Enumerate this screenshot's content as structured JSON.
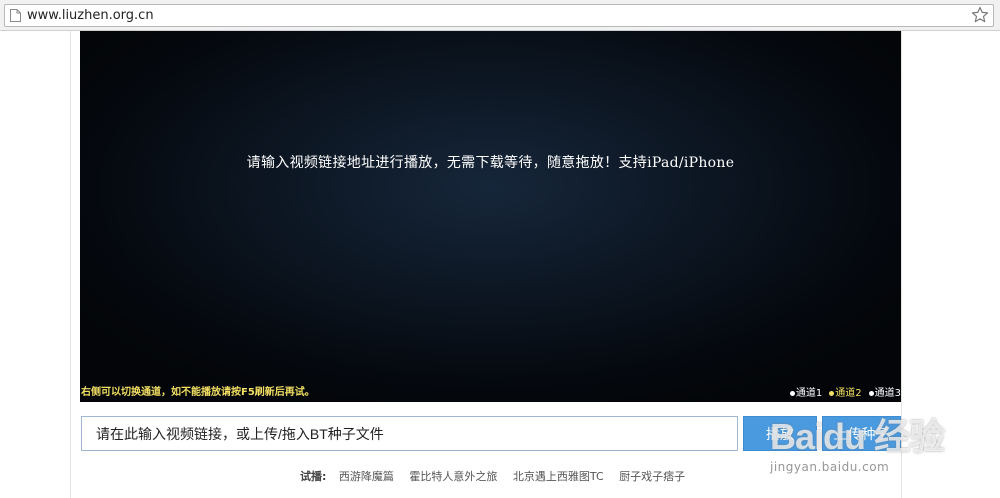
{
  "browser": {
    "url": "www.liuzhen.org.cn"
  },
  "player": {
    "message": "请输入视频链接地址进行播放，无需下载等待，随意拖放！支持iPad/iPhone",
    "hint": "右侧可以切换通道，如不能播放请按F5刷新后再试。",
    "channels": [
      {
        "label": "通道1",
        "active": false
      },
      {
        "label": "通道2",
        "active": true
      },
      {
        "label": "通道3",
        "active": false
      }
    ]
  },
  "search": {
    "placeholder": "请在此输入视频链接，或上传/拖入BT种子文件",
    "play_label": "播放",
    "upload_label": "上传种子"
  },
  "try_play": {
    "label": "试播:",
    "items": [
      "西游降魔篇",
      "霍比特人意外之旅",
      "北京遇上西雅图TC",
      "厨子戏子痞子"
    ]
  },
  "watermark": {
    "brand": "Baidu 经验",
    "site": "jingyan.baidu.com"
  },
  "colors": {
    "hint_yellow": "#f2df64",
    "button_blue": "#4a9ae0",
    "player_bg": "#05090f"
  }
}
